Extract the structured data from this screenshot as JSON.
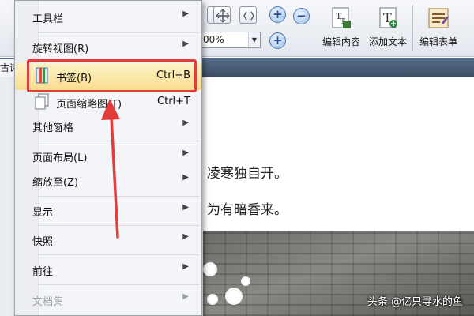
{
  "toolbar": {
    "zoom_value": "00%",
    "buttons": [
      {
        "label": "编辑内容"
      },
      {
        "label": "添加文本"
      },
      {
        "label": "编辑表单"
      }
    ]
  },
  "tab": {
    "label": "古诗"
  },
  "document": {
    "line1": "凌寒独自开。",
    "line2": "为有暗香来。",
    "watermark": "头条 @亿只寻水的鱼"
  },
  "menu": {
    "items": [
      {
        "label": "工具栏",
        "has_submenu": true
      },
      {
        "label": "旋转视图(R)",
        "has_submenu": true
      },
      {
        "label": "书签(B)",
        "shortcut": "Ctrl+B",
        "highlighted": true
      },
      {
        "label": "页面缩略图(T)",
        "shortcut": "Ctrl+T"
      },
      {
        "label": "其他窗格",
        "has_submenu": true
      },
      {
        "label": "页面布局(L)",
        "has_submenu": true
      },
      {
        "label": "缩放至(Z)",
        "has_submenu": true
      },
      {
        "label": "显示",
        "has_submenu": true
      },
      {
        "label": "快照",
        "has_submenu": true
      },
      {
        "label": "前往",
        "has_submenu": true
      },
      {
        "label": "文档集",
        "has_submenu": true,
        "disabled": true
      }
    ]
  },
  "colors": {
    "highlight_box": "#e23b3b",
    "annotation_arrow": "#e23b3b"
  }
}
